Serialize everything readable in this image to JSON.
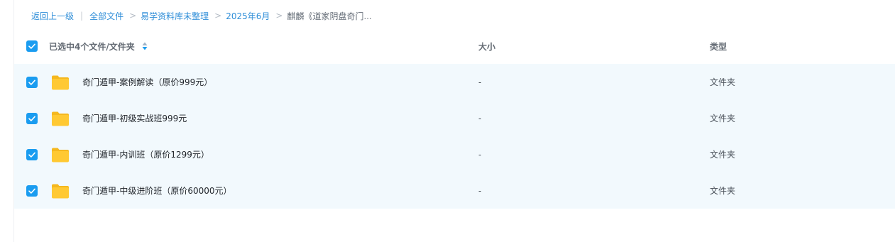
{
  "breadcrumb": {
    "back_label": "返回上一级",
    "separator_pipe": "|",
    "items": [
      "全部文件",
      "易学资料库未整理",
      "2025年6月"
    ],
    "current": "麒麟《道家阴盘奇门..."
  },
  "table": {
    "header": {
      "selection_label": "已选中4个文件/文件夹",
      "size_label": "大小",
      "type_label": "类型",
      "all_checked": true,
      "sort_icon": "sort-updown-icon"
    },
    "rows": [
      {
        "name": "奇门遁甲-案例解读（原价999元）",
        "size": "-",
        "type": "文件夹",
        "checked": true,
        "icon": "folder-icon"
      },
      {
        "name": "奇门遁甲-初级实战班999元",
        "size": "-",
        "type": "文件夹",
        "checked": true,
        "icon": "folder-icon"
      },
      {
        "name": "奇门遁甲-内训班（原价1299元）",
        "size": "-",
        "type": "文件夹",
        "checked": true,
        "icon": "folder-icon"
      },
      {
        "name": "奇门遁甲-中级进阶班（原价60000元）",
        "size": "-",
        "type": "文件夹",
        "checked": true,
        "icon": "folder-icon"
      }
    ]
  },
  "colors": {
    "accent": "#1a9cf0",
    "link": "#2f8ed8",
    "selected_row_bg": "#f2f9fd",
    "folder": "#ffc933"
  }
}
